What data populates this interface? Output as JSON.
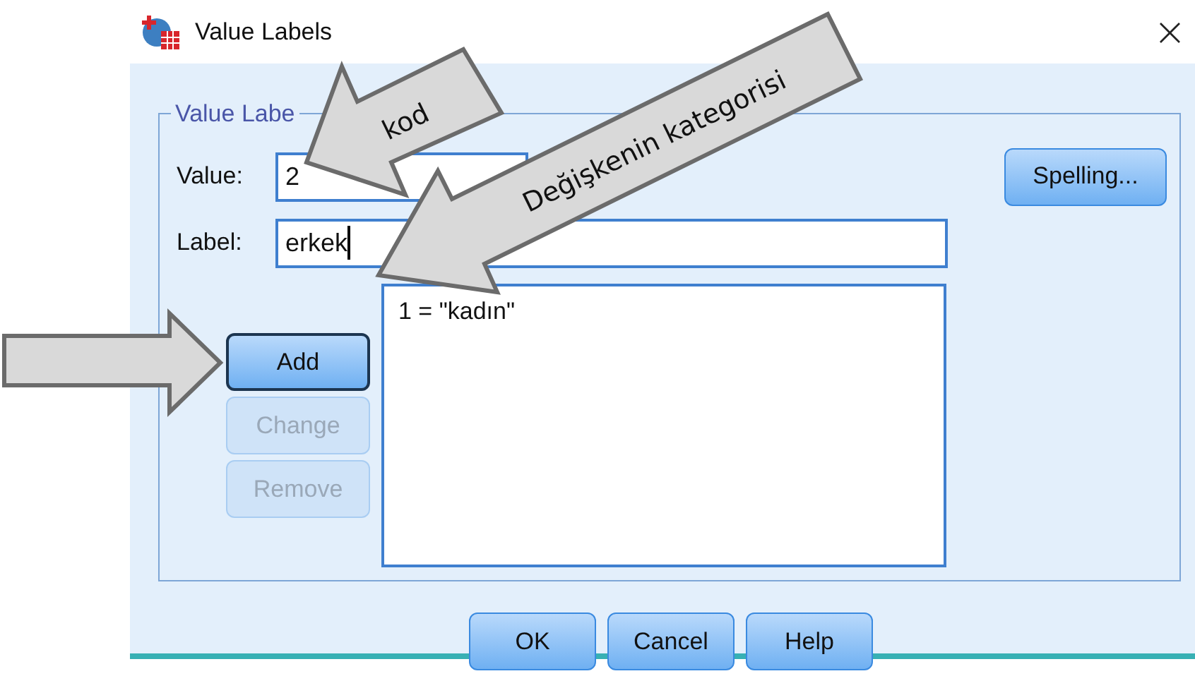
{
  "window": {
    "title": "Value Labels",
    "close": "×"
  },
  "group": {
    "legend": "Value Labe"
  },
  "value_field": {
    "label": "Value:",
    "value": "2"
  },
  "label_field": {
    "label": "Label:",
    "value": "erkek",
    "focused": true
  },
  "spelling_button": {
    "label": "Spelling...",
    "disabled": false
  },
  "side_buttons": [
    {
      "label": "Add",
      "default": true,
      "disabled": false
    },
    {
      "label": "Change",
      "default": false,
      "disabled": true
    },
    {
      "label": "Remove",
      "default": false,
      "disabled": true
    }
  ],
  "value_list": [
    {
      "text": "1 = \"kadın\""
    }
  ],
  "footer_buttons": [
    {
      "label": "OK"
    },
    {
      "label": "Cancel"
    },
    {
      "label": "Help"
    }
  ],
  "annotations": [
    {
      "kind": "callout",
      "text": "kod"
    },
    {
      "kind": "callout",
      "text": "Değişkenin kategorisi"
    },
    {
      "kind": "pointer"
    }
  ]
}
